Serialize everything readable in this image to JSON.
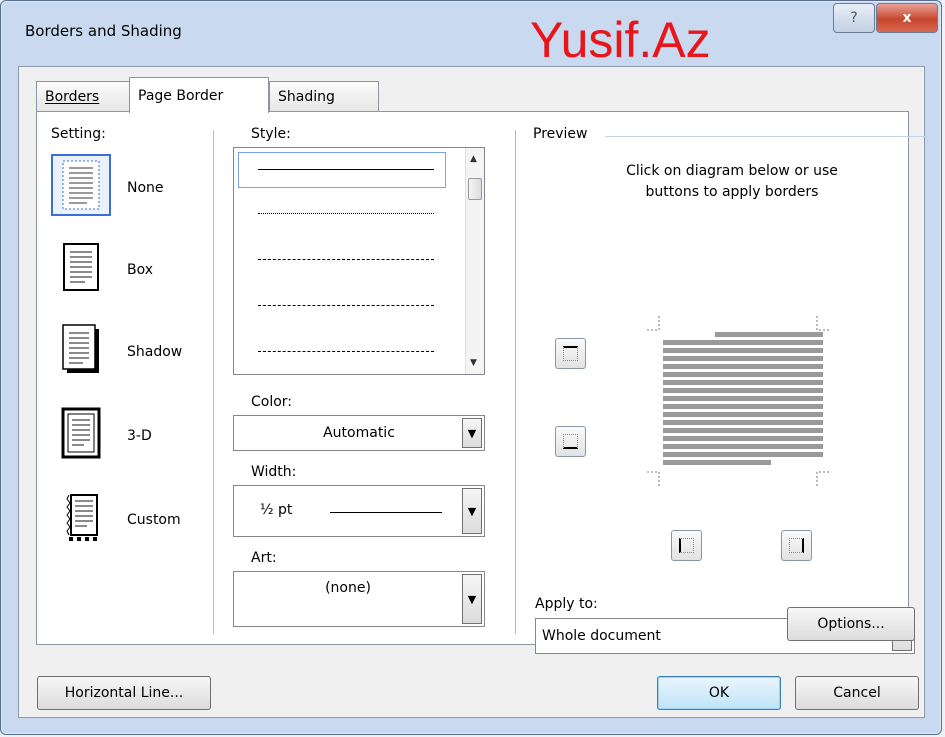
{
  "window": {
    "title": "Borders and Shading",
    "help_glyph": "?",
    "close_glyph": "x"
  },
  "watermark": "Yusif.Az",
  "tabs": [
    {
      "label": "Borders",
      "active": false
    },
    {
      "label": "Page Border",
      "active": true
    },
    {
      "label": "Shading",
      "active": false
    }
  ],
  "setting": {
    "label": "Setting:",
    "items": [
      {
        "label": "None",
        "selected": true
      },
      {
        "label": "Box",
        "selected": false
      },
      {
        "label": "Shadow",
        "selected": false
      },
      {
        "label": "3-D",
        "selected": false
      },
      {
        "label": "Custom",
        "selected": false
      }
    ]
  },
  "style": {
    "label": "Style:",
    "options": [
      "solid",
      "dotted",
      "dashed-small",
      "dashed-medium",
      "dash-dot"
    ],
    "selected": "solid"
  },
  "color": {
    "label": "Color:",
    "value": "Automatic"
  },
  "width": {
    "label": "Width:",
    "value": "½ pt"
  },
  "art": {
    "label": "Art:",
    "value": "(none)"
  },
  "preview": {
    "label": "Preview",
    "instructions": "Click on diagram below or use\nbuttons to apply borders",
    "instructions_line1": "Click on diagram below or use",
    "instructions_line2": "buttons to apply borders"
  },
  "apply_to": {
    "label": "Apply to:",
    "value": "Whole document"
  },
  "buttons": {
    "options": "Options...",
    "horizontal_line": "Horizontal Line...",
    "ok": "OK",
    "cancel": "Cancel"
  },
  "colors": {
    "accent_red": "#e8151b",
    "selection_blue": "#3a6fd8"
  }
}
